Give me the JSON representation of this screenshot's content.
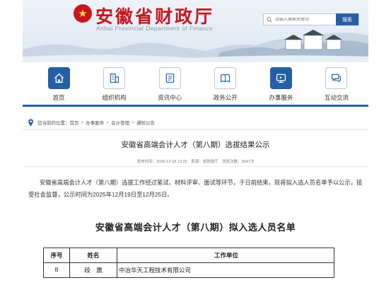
{
  "header": {
    "site_title": "安徽省财政厅",
    "site_subtitle_en": "Anhui Provincial Department of Finance",
    "search": {
      "placeholder": "请输入搜索关键词",
      "button_label": "搜索"
    },
    "brand_color": "#c8161d",
    "accent_color": "#2460a7"
  },
  "nav": {
    "items": [
      {
        "label": "首页",
        "icon": "home-icon",
        "active": true
      },
      {
        "label": "组织机构",
        "icon": "building-icon",
        "active": false
      },
      {
        "label": "资讯中心",
        "icon": "document-icon",
        "active": false
      },
      {
        "label": "政务公开",
        "icon": "book-icon",
        "active": false
      },
      {
        "label": "办事服务",
        "icon": "monitor-icon",
        "active": true
      },
      {
        "label": "互动交流",
        "icon": "chat-icon",
        "active": false
      }
    ]
  },
  "breadcrumb": {
    "prefix": "您当前的位置：",
    "items": [
      "首页",
      "办事服务",
      "会计管理",
      "通知公告"
    ],
    "separator": ">"
  },
  "article": {
    "title": "安徽省高端会计人才（第八期）选拔结果公示",
    "meta": {
      "published": "发布时间：2025-12-18 13:26",
      "source": "来源：省财政厅",
      "views": "浏览次数：3047次"
    },
    "body": "安徽省高端会计人才（第八期）选拔工作经过笔试、材料评审、面试等环节，于日前结束。现将拟入选人员名单予以公示，接受社会监督，公示时间为2025年12月19日至12月25日。",
    "list_title": "安徽省高端会计人才（第八期）拟入选人员名单"
  },
  "table": {
    "headers": [
      "序号",
      "姓名",
      "工作单位"
    ],
    "rows": [
      [
        "8",
        "段　震",
        "中冶华天工程技术有限公司"
      ]
    ]
  }
}
